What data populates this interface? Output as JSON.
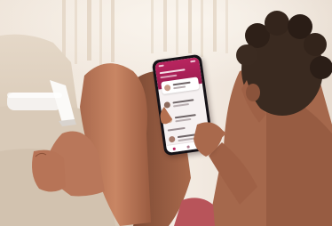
{
  "photo": {
    "phone_app": {
      "accent_color": "#b9255f",
      "conversation_rows": 5
    }
  }
}
